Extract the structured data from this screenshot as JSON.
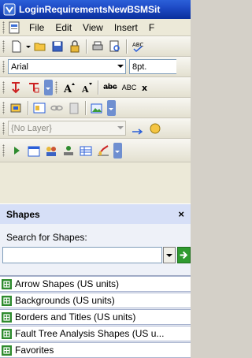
{
  "window": {
    "title": "LoginRequirementsNewBSMSit"
  },
  "menu": {
    "items": [
      {
        "label": "File",
        "access": "F"
      },
      {
        "label": "Edit",
        "access": "E"
      },
      {
        "label": "View",
        "access": "V"
      },
      {
        "label": "Insert",
        "access": "I"
      },
      {
        "label": "F",
        "access": ""
      }
    ]
  },
  "format_toolbar": {
    "font": "Arial",
    "size": "8pt."
  },
  "text_toolbar": {
    "abc_label": "abc",
    "ABC_label": "ABC"
  },
  "layer_toolbar": {
    "layer": "{No Layer}"
  },
  "shapes_panel": {
    "title": "Shapes",
    "close_glyph": "×",
    "search_label": "Search for Shapes:",
    "search_value": "",
    "stencils": [
      {
        "label": "Arrow Shapes (US units)"
      },
      {
        "label": "Backgrounds (US units)"
      },
      {
        "label": "Borders and Titles (US units)"
      },
      {
        "label": "Fault Tree Analysis Shapes (US u..."
      },
      {
        "label": "Favorites"
      }
    ]
  },
  "colors": {
    "title_bar": "#1e4bc6",
    "panel_header": "#d6dff7",
    "go_button": "#2f9a2f",
    "stencil_icon": "#2e8b2e"
  }
}
